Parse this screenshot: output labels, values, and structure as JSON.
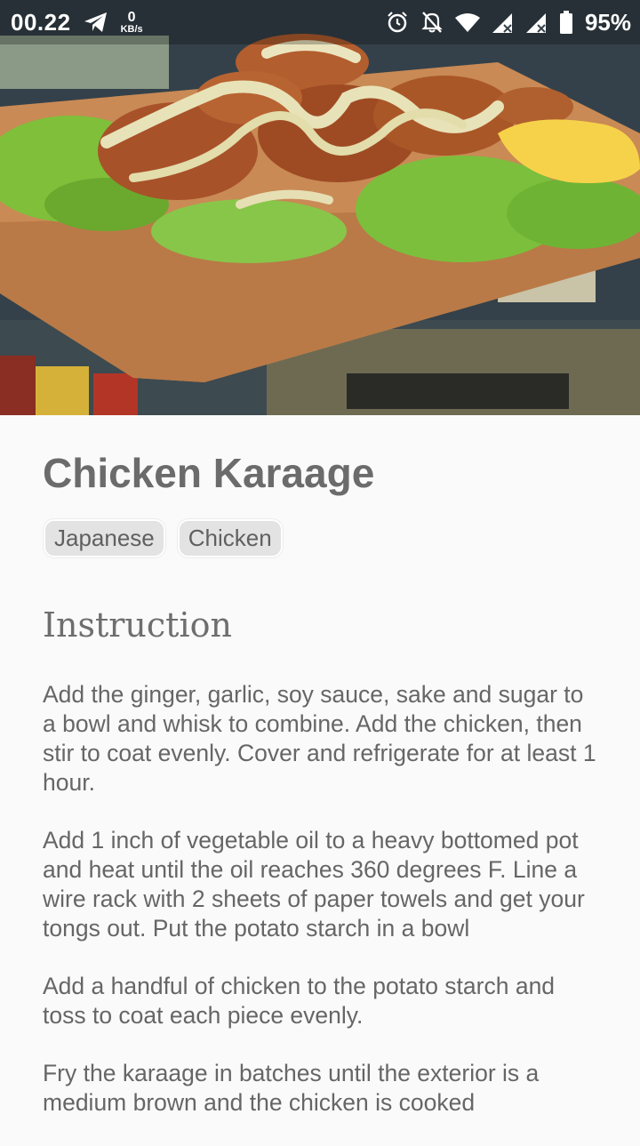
{
  "status_bar": {
    "time": "00.22",
    "speed_value": "0",
    "speed_unit": "KB/s",
    "battery": "95%"
  },
  "hero": {
    "image": "fried-chicken-karaage-on-wooden-board",
    "colors": {
      "board": "#c98a55",
      "lettuce": "#7fbf3a",
      "chicken": "#a8522a",
      "sauce": "#e8e2b8",
      "lemon": "#f6d24a"
    }
  },
  "recipe": {
    "title": "Chicken Karaage",
    "tags": [
      "Japanese",
      "Chicken"
    ],
    "section_title": "Instruction",
    "instructions": [
      "Add the ginger, garlic, soy sauce, sake and sugar to a bowl and whisk to combine. Add the chicken, then stir to coat evenly. Cover and refrigerate for at least 1 hour.",
      "Add 1 inch of vegetable oil to a heavy bottomed pot and heat until the oil reaches 360 degrees F. Line a wire rack with 2 sheets of paper towels and get your tongs out. Put the potato starch in a bowl",
      "Add a handful of chicken to the potato starch and toss to coat each piece evenly.",
      "Fry the karaage in batches until the exterior is a medium brown and the chicken is cooked"
    ]
  }
}
